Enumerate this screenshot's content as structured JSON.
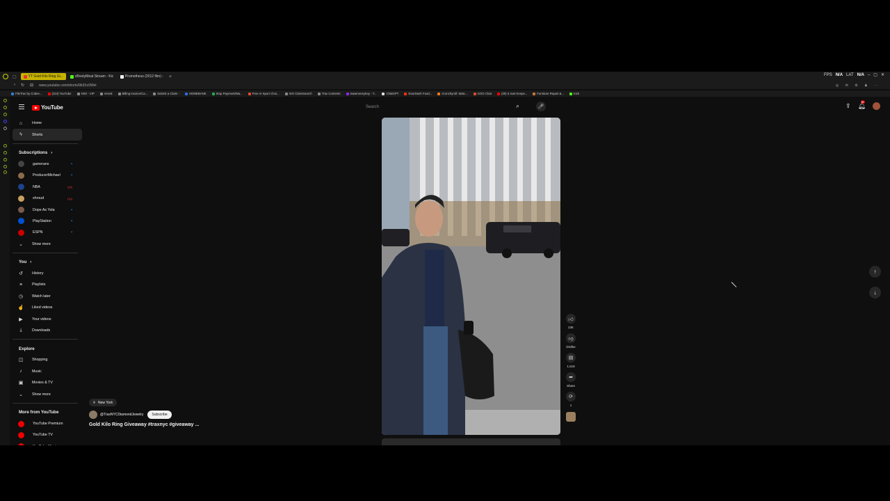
{
  "browser": {
    "tabs": [
      {
        "label": "YT Gold Kilo Ring Gi...",
        "color": "#e23b2e",
        "active": true
      },
      {
        "label": "xBootyMeat Stream - Kic",
        "color": "#53fc18",
        "active": false
      },
      {
        "label": "Prometheus (2012 film) -",
        "color": "#ffffff",
        "active": false
      }
    ],
    "url": "www.youtube.com/shorts/9b3Xc0Wel",
    "perf": {
      "fps_label": "FPS",
      "fps_value": "N/A",
      "lat_label": "LAT",
      "lat_value": "N/A"
    },
    "bookmarks": [
      {
        "label": "FileTrac by Cridee...",
        "color": "#3a7bd5"
      },
      {
        "label": "(224) YouTube",
        "color": "#ff0000"
      },
      {
        "label": "NISI - VIP",
        "color": "#888888"
      },
      {
        "label": "Venok",
        "color": "#888888"
      },
      {
        "label": "Billing Invoice/Ca...",
        "color": "#888888"
      },
      {
        "label": "Submit a Claim -",
        "color": "#888888"
      },
      {
        "label": "HOMEBANK",
        "color": "#2d6cdf"
      },
      {
        "label": "Stop Payment/Wa...",
        "color": "#22aa55"
      },
      {
        "label": "Free AI Sport Choi...",
        "color": "#e24a2e"
      },
      {
        "label": "ISO ClaimSearch",
        "color": "#888888"
      },
      {
        "label": "Trax Contents",
        "color": "#888888"
      },
      {
        "label": "isawmoneyboy - T...",
        "color": "#8a2be2"
      },
      {
        "label": "ChatGPT",
        "color": "#dddddd"
      },
      {
        "label": "DoorDash Food...",
        "color": "#ff3008"
      },
      {
        "label": "Crunchyroll: Watc...",
        "color": "#f47521"
      },
      {
        "label": "GOO Chat",
        "color": "#e24a2e"
      },
      {
        "label": "(30) It Just Keeps...",
        "color": "#ff0000"
      },
      {
        "label": "Furniture Repair &...",
        "color": "#c87a3a"
      },
      {
        "label": "Kick",
        "color": "#53fc18"
      }
    ]
  },
  "header": {
    "logo_text": "YouTube",
    "search_placeholder": "Search",
    "notif_count": "9+"
  },
  "sidebar": {
    "main": [
      {
        "label": "Home",
        "icon": "home-icon",
        "glyph": "⌂"
      },
      {
        "label": "Shorts",
        "icon": "shorts-icon",
        "glyph": "ϟ",
        "active": true
      }
    ],
    "subscriptions_title": "Subscriptions",
    "subscriptions": [
      {
        "label": "gameranx",
        "color": "#444444",
        "badge": "dot"
      },
      {
        "label": "ProducerMichael",
        "color": "#8b6b4a",
        "badge": "dot"
      },
      {
        "label": "NBA",
        "color": "#1d428a",
        "badge": "live"
      },
      {
        "label": "shroud",
        "color": "#c8a060",
        "badge": "live"
      },
      {
        "label": "Dope As Yola",
        "color": "#7a5a4a",
        "badge": "dot"
      },
      {
        "label": "PlayStation",
        "color": "#0050d0",
        "badge": "dot"
      },
      {
        "label": "ESPN",
        "color": "#cc0000",
        "badge": "dot"
      }
    ],
    "show_more": "Show more",
    "you_title": "You",
    "you": [
      {
        "label": "History",
        "glyph": "↺"
      },
      {
        "label": "Playlists",
        "glyph": "≡"
      },
      {
        "label": "Watch later",
        "glyph": "◷"
      },
      {
        "label": "Liked videos",
        "glyph": "☝"
      },
      {
        "label": "Your videos",
        "glyph": "▶"
      },
      {
        "label": "Downloads",
        "glyph": "⤓"
      }
    ],
    "explore_title": "Explore",
    "explore": [
      {
        "label": "Shopping",
        "glyph": "◫"
      },
      {
        "label": "Music",
        "glyph": "♪"
      },
      {
        "label": "Movies & TV",
        "glyph": "▣"
      }
    ],
    "explore_show_more": "Show more",
    "more_title": "More from YouTube",
    "more": [
      {
        "label": "YouTube Premium"
      },
      {
        "label": "YouTube TV"
      },
      {
        "label": "YouTube Music"
      }
    ]
  },
  "short": {
    "location": "New York",
    "channel": "@TraxNYCDiamondJewelry",
    "subscribe_label": "Subscribe",
    "title": "Gold Kilo Ring Giveaway #traxnyc #giveaway ...",
    "likes": "23K",
    "dislike_label": "Dislike",
    "comments": "1,519",
    "share_label": "Share",
    "remix_count": "1"
  }
}
